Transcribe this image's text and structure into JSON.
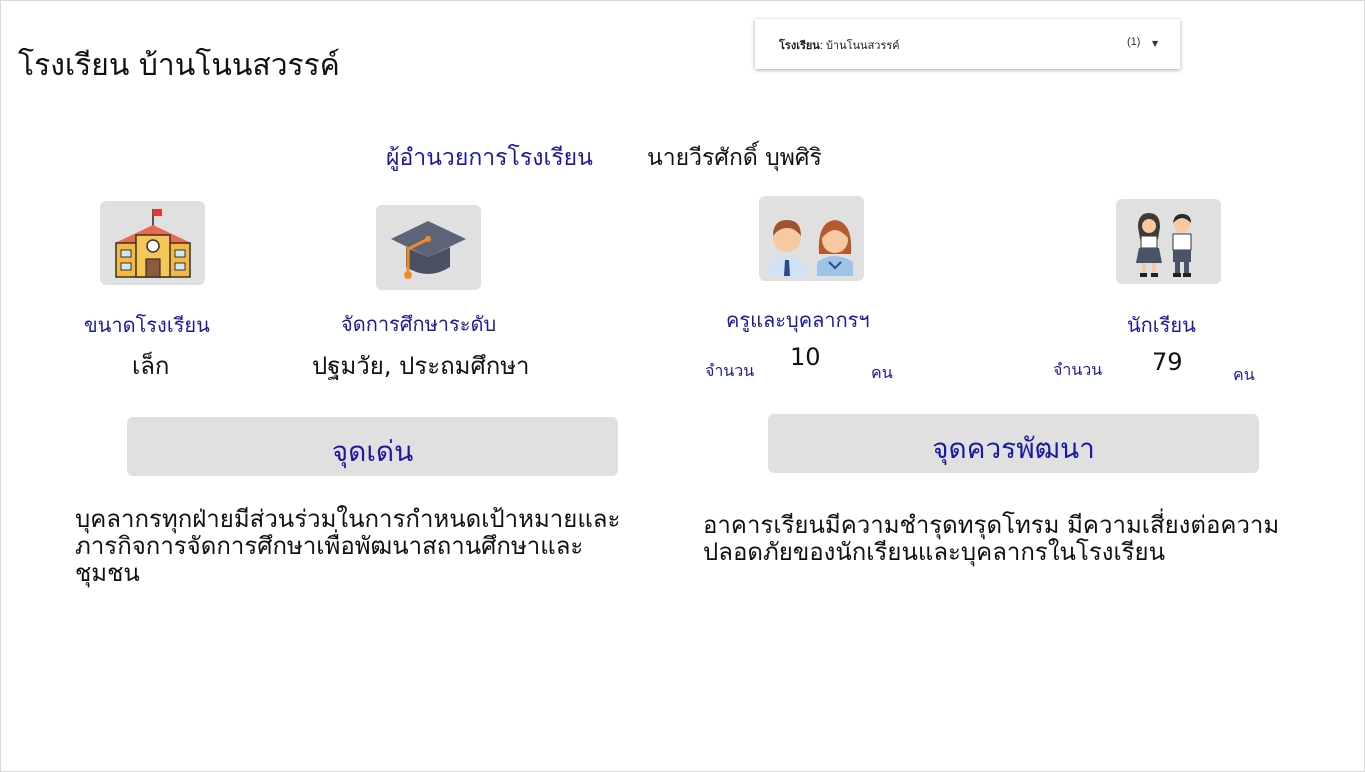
{
  "header": {
    "title": "โรงเรียน บ้านโนนสวรรค์"
  },
  "filter": {
    "label": "โรงเรียน",
    "value": "บ้านโนนสวรรค์",
    "count": "(1)"
  },
  "director": {
    "label": "ผู้อำนวยการโรงเรียน",
    "name": "นายวีรศักดิ์ บุพศิริ"
  },
  "school_size": {
    "label": "ขนาดโรงเรียน",
    "value": "เล็ก",
    "icon": "school-building-icon"
  },
  "education_level": {
    "label": "จัดการศึกษาระดับ",
    "value": "ปฐมวัย, ประถมศึกษา",
    "icon": "graduation-cap-icon"
  },
  "teachers": {
    "label": "ครูและบุคลากรฯ",
    "count_prefix": "จำนวน",
    "count": "10",
    "unit": "คน",
    "icon": "teachers-icon"
  },
  "students": {
    "label": "นักเรียน",
    "count_prefix": "จำนวน",
    "count": "79",
    "unit": "คน",
    "icon": "students-icon"
  },
  "strengths": {
    "title": "จุดเด่น",
    "text_lines": [
      "บุคลากรทุกฝ่ายมีส่วนร่วมในการกำหนดเป้าหมายและ",
      "ภารกิจการจัดการศึกษาเพื่อพัฒนาสถานศึกษาและ",
      "ชุมชน"
    ]
  },
  "improvements": {
    "title": "จุดควรพัฒนา",
    "text_lines": [
      "อาคารเรียนมีความชำรุดทรุดโทรม มีความเสี่ยงต่อความ",
      "ปลอดภัยของนักเรียนและบุคลากรในโรงเรียน"
    ]
  },
  "colors": {
    "accent": "#1a1aa0",
    "panel": "#e0e0e0"
  }
}
